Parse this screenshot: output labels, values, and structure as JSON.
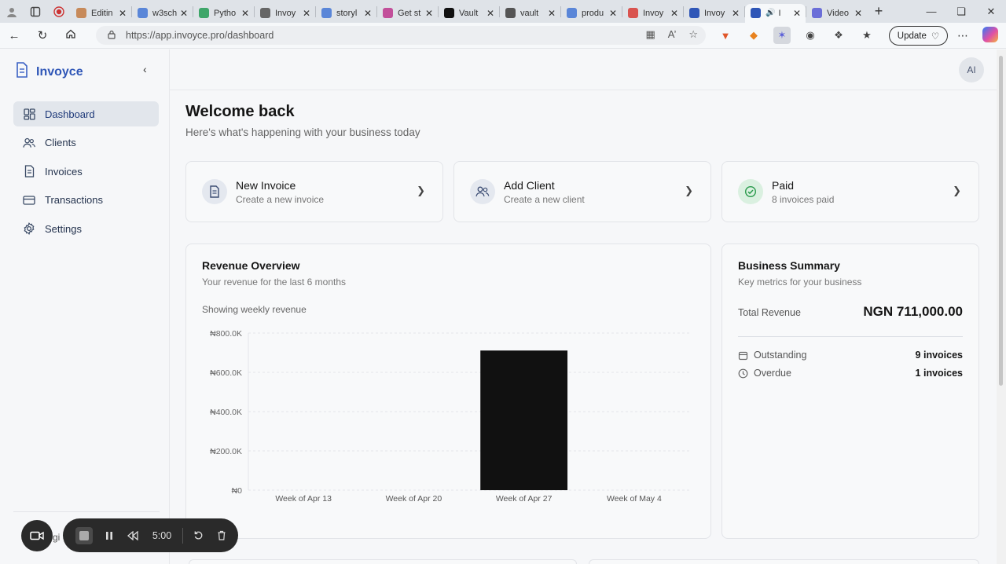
{
  "browser": {
    "tabs": [
      {
        "title": "Editin",
        "color": "#c78a5a"
      },
      {
        "title": "w3sch",
        "color": "#5a86d8"
      },
      {
        "title": "Pytho",
        "color": "#3fa66a"
      },
      {
        "title": "Invoy",
        "color": "#666666"
      },
      {
        "title": "storyl",
        "color": "#5a86d8"
      },
      {
        "title": "Get st",
        "color": "#c24f9a"
      },
      {
        "title": "Vault",
        "color": "#111111"
      },
      {
        "title": "vault",
        "color": "#555555"
      },
      {
        "title": "produ",
        "color": "#5a86d8"
      },
      {
        "title": "Invoy",
        "color": "#d9534f"
      },
      {
        "title": "Invoy",
        "color": "#2f56b7"
      },
      {
        "title": "I",
        "color": "#2f56b7"
      },
      {
        "title": "Video",
        "color": "#6b6ed8"
      }
    ],
    "url": "https://app.invoyce.pro/dashboard",
    "update_label": "Update"
  },
  "sidebar": {
    "brand": "Invoyce",
    "items": [
      {
        "label": "Dashboard",
        "icon": "dashboard-icon",
        "active": true
      },
      {
        "label": "Clients",
        "icon": "users-icon",
        "active": false
      },
      {
        "label": "Invoices",
        "icon": "file-icon",
        "active": false
      },
      {
        "label": "Transactions",
        "icon": "card-icon",
        "active": false
      },
      {
        "label": "Settings",
        "icon": "gear-icon",
        "active": false
      }
    ]
  },
  "header": {
    "avatar": "AI"
  },
  "main": {
    "title": "Welcome back",
    "subtitle": "Here's what's happening with your business today",
    "quick_actions": [
      {
        "title": "New Invoice",
        "subtitle": "Create a new invoice"
      },
      {
        "title": "Add Client",
        "subtitle": "Create a new client"
      },
      {
        "title": "Paid",
        "subtitle": "8 invoices paid"
      }
    ],
    "revenue": {
      "title": "Revenue Overview",
      "subtitle": "Your revenue for the last 6 months",
      "note": "Showing weekly revenue"
    },
    "summary": {
      "title": "Business Summary",
      "subtitle": "Key metrics for your business",
      "total_label": "Total Revenue",
      "total_value": "NGN 711,000.00",
      "outstanding_label": "Outstanding",
      "outstanding_value": "9 invoices",
      "overdue_label": "Overdue",
      "overdue_value": "1 invoices"
    }
  },
  "chart_data": {
    "type": "bar",
    "categories": [
      "Week of Apr 13",
      "Week of Apr 20",
      "Week of Apr 27",
      "Week of May 4"
    ],
    "values": [
      0,
      0,
      711000,
      0
    ],
    "ylim": [
      0,
      800000
    ],
    "yticks": [
      0,
      200000,
      400000,
      600000,
      800000
    ],
    "ytick_labels": [
      "₦0",
      "₦200.0K",
      "₦400.0K",
      "₦600.0K",
      "₦800.0K"
    ],
    "bar_color": "#111111",
    "grid": true
  },
  "recorder": {
    "time": "5:00",
    "hidden_text": "gi"
  }
}
